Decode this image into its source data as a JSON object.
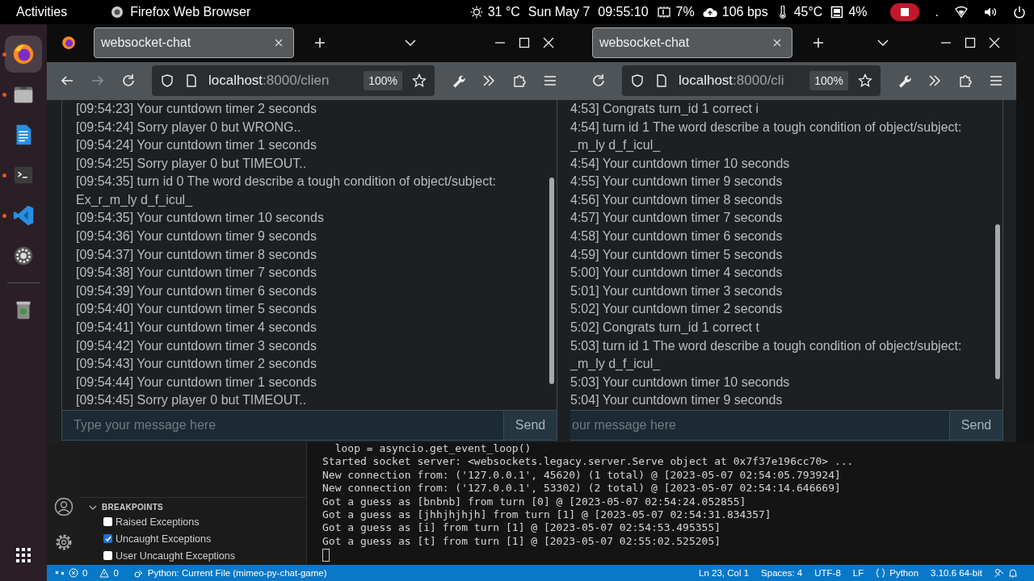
{
  "top_bar": {
    "activities": "Activities",
    "app_name": "Firefox Web Browser",
    "weather": "31 °C",
    "date": "Sun May 7",
    "time": "09:55:10",
    "cpu": "7%",
    "network": "106 bps",
    "temperature": "45°C",
    "memory": "4%",
    "indicator": "."
  },
  "dock": {
    "items": [
      {
        "kind": "firefox",
        "running": true,
        "selected": true
      },
      {
        "kind": "files",
        "running": true,
        "selected": false
      },
      {
        "kind": "document",
        "running": false,
        "selected": false
      },
      {
        "kind": "terminal",
        "running": true,
        "selected": false
      },
      {
        "kind": "code",
        "running": true,
        "selected": false
      },
      {
        "kind": "settings",
        "running": false,
        "selected": false
      },
      {
        "kind": "trash",
        "running": false,
        "selected": false
      }
    ]
  },
  "browsers": [
    {
      "tab_title": "websocket-chat",
      "nav_buttons": true,
      "forward_enabled": false,
      "url_host": "localhost",
      "url_rest": ":8000/clien",
      "zoom": "100%",
      "input_placeholder": "Type your message here",
      "send": "Send",
      "messages": [
        "[09:54:23] Your cuntdown timer 2 seconds",
        "[09:54:24] Sorry player 0 but WRONG..",
        "[09:54:24] Your cuntdown timer 1 seconds",
        "[09:54:25] Sorry player 0 but TIMEOUT..",
        "[09:54:35] turn id 0 The word describe a tough condition of object/subject: Ex_r_m_ly d_f_icul_",
        "[09:54:35] Your cuntdown timer 10 seconds",
        "[09:54:36] Your cuntdown timer 9 seconds",
        "[09:54:37] Your cuntdown timer 8 seconds",
        "[09:54:38] Your cuntdown timer 7 seconds",
        "[09:54:39] Your cuntdown timer 6 seconds",
        "[09:54:40] Your cuntdown timer 5 seconds",
        "[09:54:41] Your cuntdown timer 4 seconds",
        "[09:54:42] Your cuntdown timer 3 seconds",
        "[09:54:43] Your cuntdown timer 2 seconds",
        "[09:54:44] Your cuntdown timer 1 seconds",
        "[09:54:45] Sorry player 0 but TIMEOUT.."
      ]
    },
    {
      "tab_title": "websocket-chat",
      "nav_buttons": false,
      "url_host": "localhost",
      "url_rest": ":8000/cli",
      "zoom": "100%",
      "input_placeholder": "our message here",
      "send": "Send",
      "messages": [
        "4:53] Congrats turn_id 1 correct i",
        "4:54] turn id 1 The word describe a tough condition of object/subject: _m_ly d_f_icul_",
        "4:54] Your cuntdown timer 10 seconds",
        "4:55] Your cuntdown timer 9 seconds",
        "4:56] Your cuntdown timer 8 seconds",
        "4:57] Your cuntdown timer 7 seconds",
        "4:58] Your cuntdown timer 6 seconds",
        "4:59] Your cuntdown timer 5 seconds",
        "5:00] Your cuntdown timer 4 seconds",
        "5:01] Your cuntdown timer 3 seconds",
        "5:02] Your cuntdown timer 2 seconds",
        "5:02] Congrats turn_id 1 correct t",
        "5:03] turn id 1 The word describe a tough condition of object/subject: _m_ly d_f_icul_",
        "5:03] Your cuntdown timer 10 seconds",
        "5:04] Your cuntdown timer 9 seconds"
      ]
    }
  ],
  "debug_panel": {
    "section": "BREAKPOINTS",
    "expanded": true,
    "items": [
      {
        "label": "Raised Exceptions",
        "checked": false
      },
      {
        "label": "Uncaught Exceptions",
        "checked": true
      },
      {
        "label": "User Uncaught Exceptions",
        "checked": false
      }
    ]
  },
  "terminal": {
    "lines": [
      "  loop = asyncio.get_event_loop()",
      "Started socket server: <websockets.legacy.server.Serve object at 0x7f37e196cc70> ...",
      "New connection from: ('127.0.0.1', 45620) (1 total) @ [2023-05-07 02:54:05.793924]",
      "New connection from: ('127.0.0.1', 53302) (2 total) @ [2023-05-07 02:54:14.646669]",
      "Got a guess as [bnbnb] from turn [0] @ [2023-05-07 02:54:24.052855]",
      "Got a guess as [jhhjhjhjh] from turn [1] @ [2023-05-07 02:54:31.834357]",
      "Got a guess as [i] from turn [1] @ [2023-05-07 02:54:53.495355]",
      "Got a guess as [t] from turn [1] @ [2023-05-07 02:55:02.525205]"
    ]
  },
  "status_bar": {
    "errors": "0",
    "warnings": "0",
    "debug_config": "Python: Current File (mimeo-py-chat-game)",
    "position": "Ln 23, Col 1",
    "spaces": "Spaces: 4",
    "encoding": "UTF-8",
    "eol": "LF",
    "language": "Python",
    "interpreter": "3.10.6 64-bit"
  }
}
